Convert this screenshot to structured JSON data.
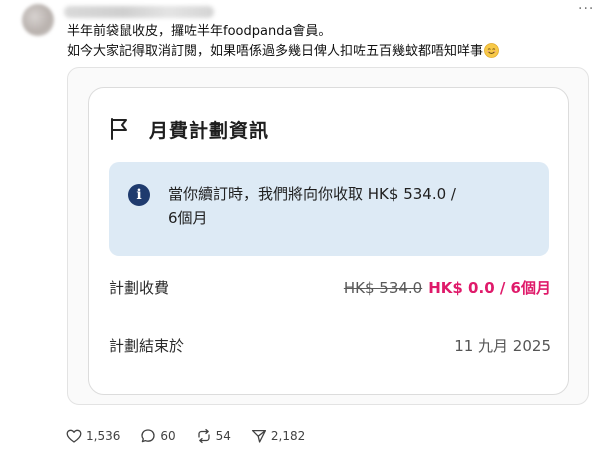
{
  "post": {
    "lines": [
      "半年前袋鼠收皮，攞咗半年foodpanda會員。",
      "如今大家記得取消訂閱，如果唔係過多幾日俾人扣咗五百幾蚊都唔知咩事"
    ],
    "more_label": "···"
  },
  "card": {
    "title": "月費計劃資訊",
    "notice_line1": "當你續訂時，我們將向你收取 HK$ 534.0 /",
    "notice_line2": "6個月",
    "fee_label": "計劃收費",
    "fee_old": "HK$ 534.0",
    "fee_new": "HK$ 0.0 / 6個月",
    "end_label": "計劃結束於",
    "end_date": "11 九月 2025"
  },
  "actions": {
    "likes": "1,536",
    "replies": "60",
    "reposts": "54",
    "shares": "2,182"
  },
  "colors": {
    "accent_price": "#df1a6a",
    "notice_bg": "#ddeaf5",
    "info_icon": "#1f3b6e"
  },
  "icons": [
    "flag-icon",
    "info-icon",
    "heart-icon",
    "comment-icon",
    "repost-icon",
    "share-icon",
    "smiling-face-emoji"
  ]
}
